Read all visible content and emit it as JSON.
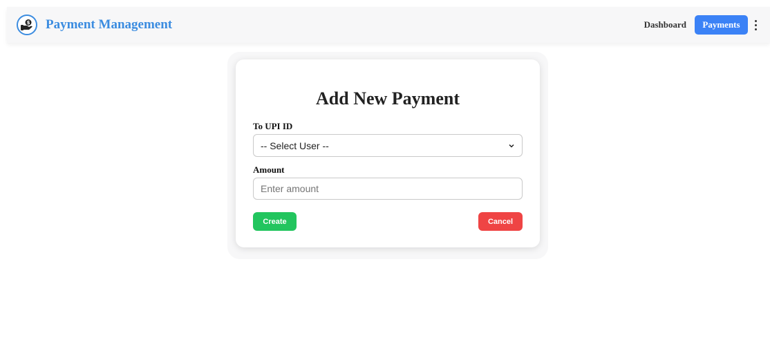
{
  "navbar": {
    "brand_title": "Payment Management",
    "brand_icon": "hand-dollar-icon",
    "links": [
      {
        "label": "Dashboard",
        "active": false
      },
      {
        "label": "Payments",
        "active": true
      }
    ],
    "menu_icon": "kebab-menu-icon"
  },
  "form": {
    "title": "Add New Payment",
    "upi_label": "To UPI ID",
    "upi_selected": "-- Select User --",
    "amount_label": "Amount",
    "amount_placeholder": "Enter amount",
    "create_label": "Create",
    "cancel_label": "Cancel"
  },
  "colors": {
    "brand": "#3b8ce0",
    "active_nav": "#3b82f6",
    "create": "#22c55e",
    "cancel": "#ef4444"
  }
}
